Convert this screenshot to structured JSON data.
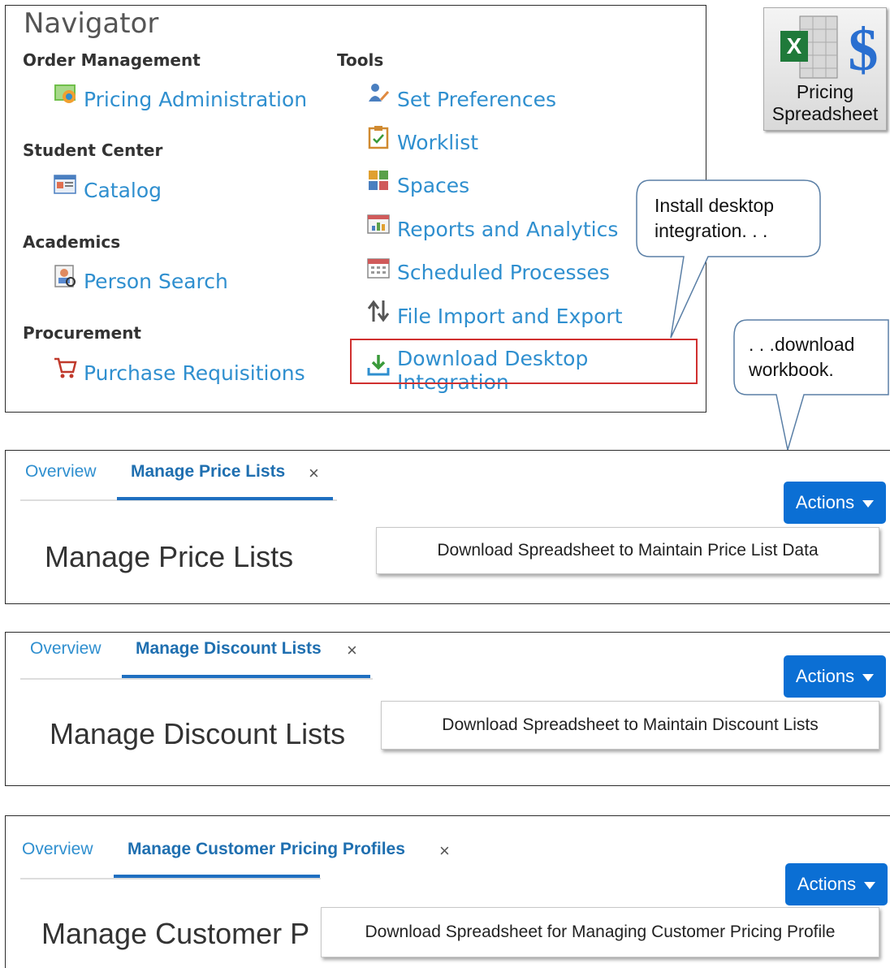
{
  "navigator": {
    "title": "Navigator",
    "sections": [
      {
        "heading": "Order Management",
        "items": [
          {
            "label": "Pricing Administration",
            "icon": "pricing-admin-icon"
          }
        ]
      },
      {
        "heading": "Student Center",
        "items": [
          {
            "label": "Catalog",
            "icon": "catalog-icon"
          }
        ]
      },
      {
        "heading": "Academics",
        "items": [
          {
            "label": "Person Search",
            "icon": "person-search-icon"
          }
        ]
      },
      {
        "heading": "Procurement",
        "items": [
          {
            "label": "Purchase Requisitions",
            "icon": "cart-icon"
          }
        ]
      }
    ],
    "tools": {
      "heading": "Tools",
      "items": [
        {
          "label": "Set Preferences",
          "icon": "preferences-icon"
        },
        {
          "label": "Worklist",
          "icon": "worklist-icon"
        },
        {
          "label": "Spaces",
          "icon": "spaces-icon"
        },
        {
          "label": "Reports and Analytics",
          "icon": "reports-icon"
        },
        {
          "label": "Scheduled Processes",
          "icon": "calendar-icon"
        },
        {
          "label": "File Import and Export",
          "icon": "import-export-icon"
        },
        {
          "label": "Download Desktop Integration",
          "icon": "download-icon"
        }
      ]
    }
  },
  "tile": {
    "line1": "Pricing",
    "line2": "Spreadsheet"
  },
  "callouts": {
    "install": {
      "line1": "Install desktop",
      "line2": "integration. . ."
    },
    "download": {
      "line1": ". . .download",
      "line2": "workbook."
    }
  },
  "panels": [
    {
      "overview": "Overview",
      "tab": "Manage Price Lists",
      "close": "×",
      "heading": "Manage Price Lists",
      "actions": "Actions",
      "menu_item": "Download Spreadsheet to Maintain Price List Data"
    },
    {
      "overview": "Overview",
      "tab": "Manage Discount Lists",
      "close": "×",
      "heading": "Manage Discount Lists",
      "actions": "Actions",
      "menu_item": "Download Spreadsheet to Maintain Discount Lists"
    },
    {
      "overview": "Overview",
      "tab": "Manage Customer Pricing Profiles",
      "close": "×",
      "heading": "Manage Customer P",
      "actions": "Actions",
      "menu_item": "Download Spreadsheet for Managing Customer Pricing Profile"
    }
  ],
  "colors": {
    "link": "#2f8fcf",
    "active_tab": "#1f6fb0",
    "actions_button": "#0b6fd4",
    "highlight": "#d0302f"
  }
}
